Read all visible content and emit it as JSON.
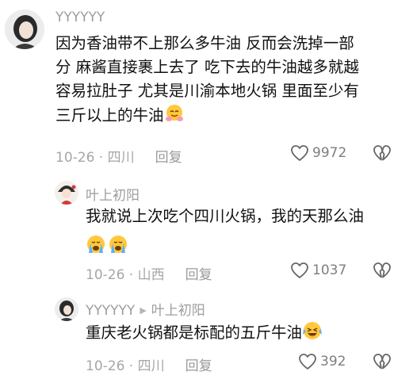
{
  "comments": [
    {
      "username": "YYYYYY",
      "text_lines": [
        "因为香油带不上那么多牛油 反而会洗掉一部",
        "分 麻酱直接裹上去了 吃下去的牛油越多就越",
        "容易拉肚子 尤其是川渝本地火锅 里面至少有",
        "三斤以上的牛油"
      ],
      "emoji": "hugging-face-emoji",
      "meta": "10-26 · 四川",
      "reply_label": "回复",
      "likes": "9972"
    },
    {
      "username": "叶上初阳",
      "text_lines": [
        "我就说上次吃个四川火锅，我的天那么油"
      ],
      "emoji": "crying-face-emoji",
      "meta": "10-26 · 山西",
      "reply_label": "回复",
      "likes": "1037"
    },
    {
      "username": "YYYYYY",
      "reply_to": "叶上初阳",
      "text_lines": [
        "重庆老火锅都是标配的五斤牛油"
      ],
      "emoji": "laughing-crying-emoji",
      "meta": "10-26 · 四川",
      "reply_label": "回复",
      "likes": "392"
    }
  ]
}
